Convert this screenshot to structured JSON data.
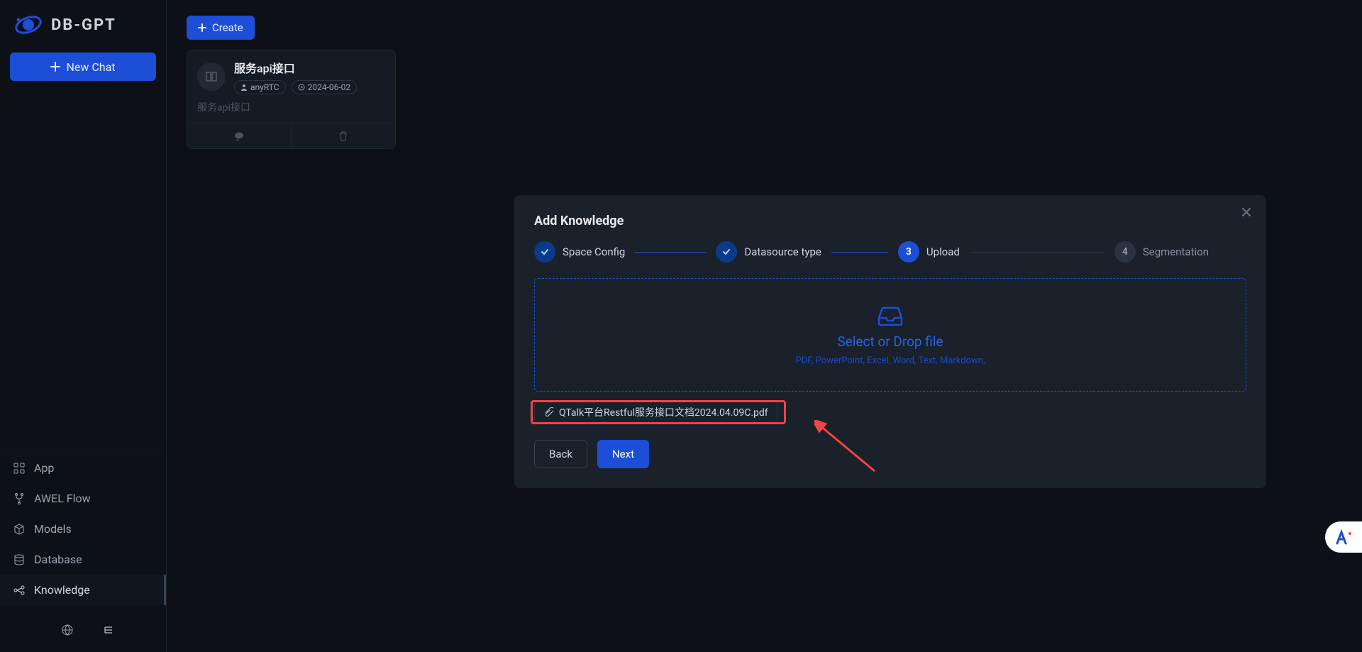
{
  "brand": {
    "name": "DB-GPT"
  },
  "sidebar": {
    "new_chat": "New Chat",
    "nav": [
      {
        "label": "App"
      },
      {
        "label": "AWEL Flow"
      },
      {
        "label": "Models"
      },
      {
        "label": "Database"
      },
      {
        "label": "Knowledge"
      }
    ]
  },
  "toolbar": {
    "create": "Create"
  },
  "card": {
    "title": "服务api接口",
    "owner": "anyRTC",
    "date": "2024-06-02",
    "desc": "服务api接口"
  },
  "modal": {
    "title": "Add Knowledge",
    "steps": [
      {
        "label": "Space Config",
        "state": "done"
      },
      {
        "label": "Datasource type",
        "state": "done"
      },
      {
        "label": "Upload",
        "state": "active",
        "num": "3"
      },
      {
        "label": "Segmentation",
        "state": "wait",
        "num": "4"
      }
    ],
    "drop": {
      "title": "Select or Drop file",
      "sub": "PDF, PowerPoint, Excel, Word, Text, Markdown,"
    },
    "file": {
      "name": "QTalk平台Restful服务接口文档2024.04.09C.pdf"
    },
    "actions": {
      "back": "Back",
      "next": "Next"
    }
  }
}
